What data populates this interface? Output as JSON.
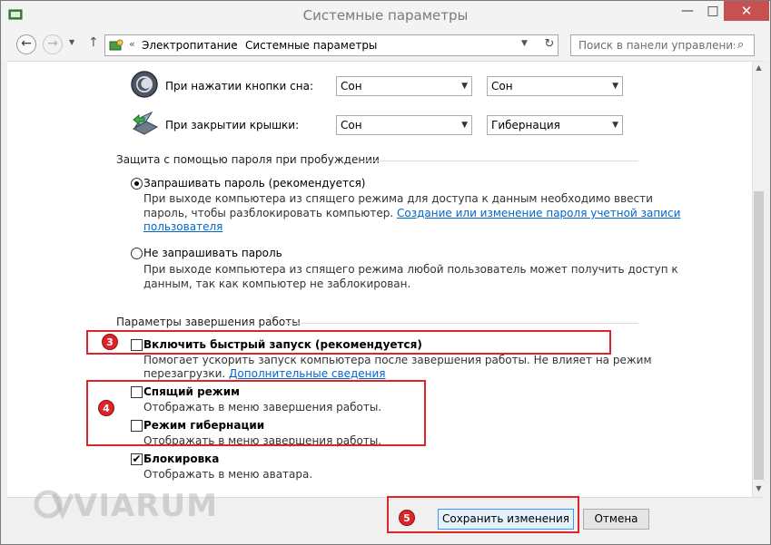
{
  "window": {
    "title": "Системные параметры",
    "controls": {
      "minimize": "—",
      "maximize": "□",
      "close": "✕"
    }
  },
  "nav": {
    "back": "←",
    "forward": "→",
    "recent": "▼",
    "up": "↑",
    "address_sep_root": "«",
    "crumbs": [
      "Электропитание",
      "Системные параметры"
    ],
    "crumb_sep": "›",
    "address_dropdown": "▼",
    "refresh": "↻",
    "search_placeholder": "Поиск в панели управления",
    "search_icon": "⌕"
  },
  "power_rows": [
    {
      "label": "При нажатии кнопки сна:",
      "battery": "Сон",
      "plugged": "Сон",
      "icon": "sleep-button-icon"
    },
    {
      "label": "При закрытии крышки:",
      "battery": "Сон",
      "plugged": "Гибернация",
      "icon": "laptop-lid-icon"
    }
  ],
  "password_section": {
    "title": "Защита с помощью пароля при пробуждении",
    "options": [
      {
        "label": "Запрашивать пароль (рекомендуется)",
        "selected": true,
        "desc_line1": "При выходе компьютера из спящего режима для доступа к данным необходимо ввести",
        "desc_line2": "пароль, чтобы разблокировать компьютер. ",
        "link_line2": "Создание или изменение пароля учетной записи",
        "link_line3": "пользователя"
      },
      {
        "label": "Не запрашивать пароль",
        "selected": false,
        "desc_line1": "При выходе компьютера из спящего режима любой пользователь может получить доступ к",
        "desc_line2": "данным, так как компьютер не заблокирован."
      }
    ]
  },
  "shutdown_section": {
    "title": "Параметры завершения работы",
    "options": [
      {
        "label": "Включить быстрый запуск (рекомендуется)",
        "checked": false,
        "desc_line1": "Помогает ускорить запуск компьютера после завершения работы. Не влияет на режим",
        "desc_line2": "перезагрузки. ",
        "link": "Дополнительные сведения"
      },
      {
        "label": "Спящий режим",
        "checked": false,
        "desc_line1": "Отображать в меню завершения работы."
      },
      {
        "label": "Режим гибернации",
        "checked": false,
        "desc_line1": "Отображать в меню завершения работы."
      },
      {
        "label": "Блокировка",
        "checked": true,
        "check_mark": "✔",
        "desc_line1": "Отображать в меню аватара."
      }
    ]
  },
  "footer": {
    "save_label": "Сохранить изменения",
    "cancel_label": "Отмена"
  },
  "annotations": {
    "badge3": "3",
    "badge4": "4",
    "badge5": "5",
    "annotation_color": "#d9252b"
  },
  "watermark": "VIARUM",
  "colors": {
    "link": "#0066cc",
    "close_button": "#c75050",
    "primary_button_border": "#3399ff"
  },
  "scroll": {
    "up": "▲",
    "down": "▼"
  }
}
